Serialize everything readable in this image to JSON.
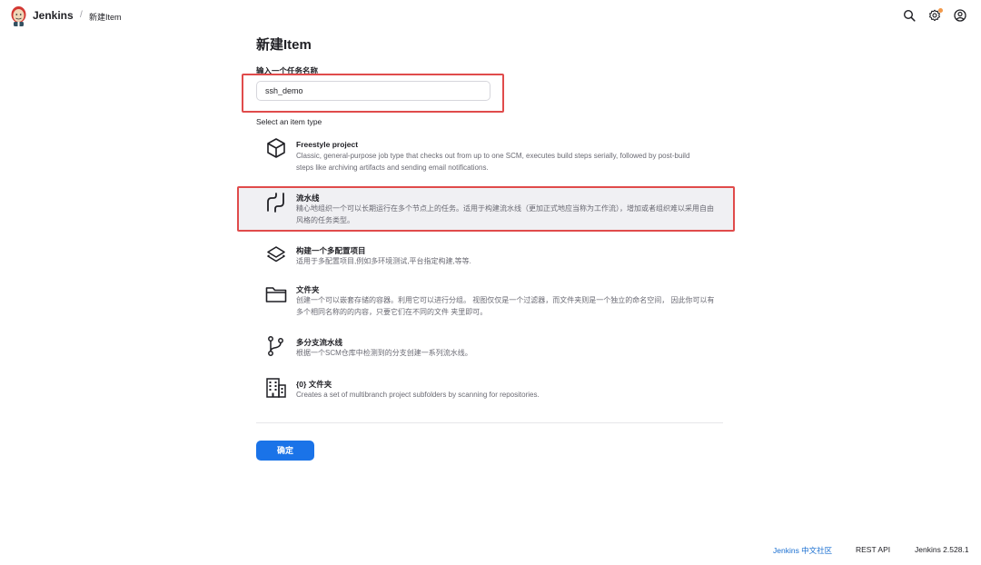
{
  "header": {
    "brand": "Jenkins",
    "breadcrumb_separator": "/",
    "breadcrumb_current": "新建Item",
    "icons": [
      "jenkins-logo-icon",
      "search-icon",
      "gear-icon",
      "user-icon"
    ]
  },
  "main": {
    "title": "新建Item",
    "name_label": "输入一个任务名称",
    "name_value": "ssh_demo",
    "type_label": "Select an item type",
    "items": [
      {
        "icon": "cube-icon",
        "title": "Freestyle project",
        "description": "Classic, general-purpose job type that checks out from up to one SCM, executes build steps serially, followed by post-build steps like archiving artifacts and sending email notifications."
      },
      {
        "icon": "pipeline-icon",
        "title": "流水线",
        "description": "精心地组织一个可以长期运行在多个节点上的任务。适用于构建流水线（更加正式地应当称为工作流），增加或者组织难以采用自由风格的任务类型。"
      },
      {
        "icon": "layers-icon",
        "title": "构建一个多配置项目",
        "description": "适用于多配置项目,例如多环境测试,平台指定构建,等等."
      },
      {
        "icon": "folder-icon",
        "title": "文件夹",
        "description": "创建一个可以嵌套存储的容器。利用它可以进行分组。 视图仅仅是一个过滤器，而文件夹则是一个独立的命名空间， 因此你可以有多个相同名称的的内容，只要它们在不同的文件 夹里即可。"
      },
      {
        "icon": "branch-icon",
        "title": "多分支流水线",
        "description": "根据一个SCM仓库中检测到的分支创建一系列流水线。"
      },
      {
        "icon": "building-icon",
        "title": "{0} 文件夹",
        "description": "Creates a set of multibranch project subfolders by scanning for repositories."
      }
    ],
    "ok_button": "确定"
  },
  "footer": {
    "community": "Jenkins 中文社区",
    "rest_api": "REST API",
    "version": "Jenkins 2.528.1"
  },
  "colors": {
    "accent": "#1a73e8",
    "highlight_border": "#e04b4b",
    "notification": "#f2994a"
  }
}
